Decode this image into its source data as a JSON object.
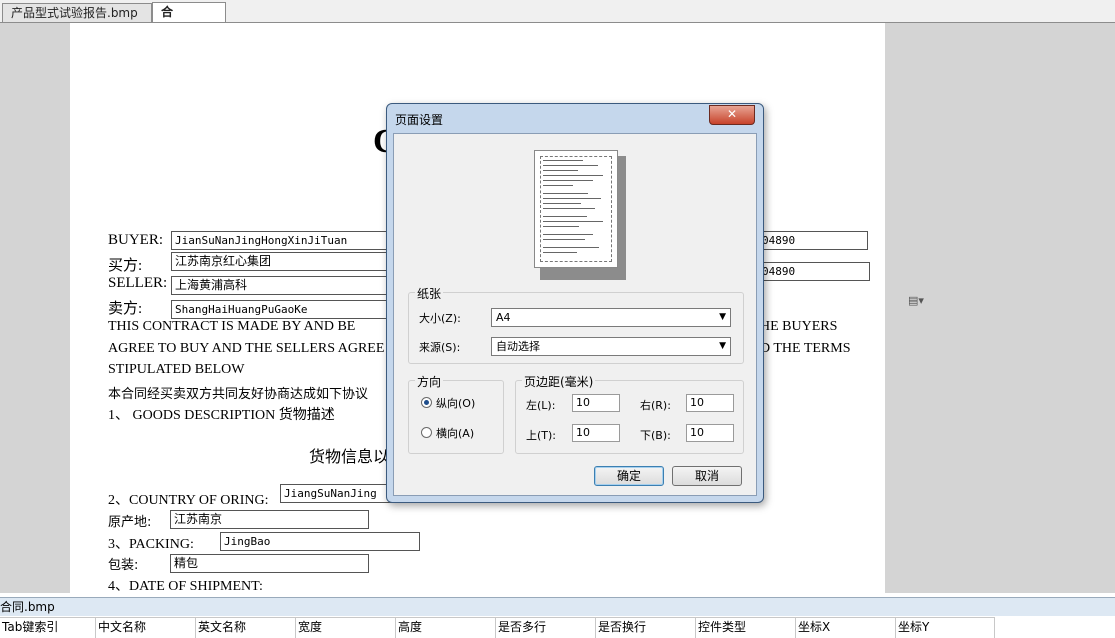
{
  "tabs": [
    {
      "label": "产品型式试验报告.bmp",
      "active": false
    },
    {
      "label": "合同.bmp",
      "active": true
    }
  ],
  "document": {
    "title_partial": "C",
    "buyer_label": "BUYER:",
    "buyer_value": "JianSuNanJingHongXinJiTuan",
    "buyer_cn_label": "买方:",
    "buyer_cn_value": "江苏南京红心集团",
    "seller_label": "SELLER:",
    "seller_value": "上海黄浦高科",
    "seller_cn_label": "卖方:",
    "seller_cn_value": "ShangHaiHuangPuGaoKe",
    "right_field_1": "04890",
    "right_field_2": "04890",
    "para_line1_left": "THIS  CONTRACT  IS  MADE  BY  AND  BE",
    "para_line1_right": "HE  BUYERS",
    "para_line2_left": "AGREE TO BUY AND THE SELLERS AGREE",
    "para_line2_right": "D THE TERMS",
    "para_line3": "STIPULATED BELOW",
    "cn_para": "本合同经买卖双方共同友好协商达成如下协议",
    "section1": "1、 GOODS DESCRIPTION  货物描述",
    "goods_info": "货物信息以",
    "section2": "2、COUNTRY OF ORING:",
    "section2_value": "JiangSuNanJing",
    "origin_label": "原产地:",
    "origin_value": "江苏南京",
    "section3": "3、PACKING:",
    "section3_value": "JingBao",
    "packing_label": "包装:",
    "packing_value": "精包",
    "section4": "4、DATE OF SHIPMENT:"
  },
  "dialog": {
    "title": "页面设置",
    "close": "✕",
    "paper_group": "纸张",
    "size_label": "大小(Z):",
    "size_value": "A4",
    "source_label": "来源(S):",
    "source_value": "自动选择",
    "orientation_group": "方向",
    "portrait": "纵向(O)",
    "landscape": "横向(A)",
    "margins_group": "页边距(毫米)",
    "left_label": "左(L):",
    "left_value": "10",
    "right_label": "右(R):",
    "right_value": "10",
    "top_label": "上(T):",
    "top_value": "10",
    "bottom_label": "下(B):",
    "bottom_value": "10",
    "ok": "确定",
    "cancel": "取消"
  },
  "bottom_panel": {
    "title": "合同.bmp",
    "columns": [
      "Tab键索引",
      "中文名称",
      "英文名称",
      "宽度",
      "高度",
      "是否多行",
      "是否换行",
      "控件类型",
      "坐标X",
      "坐标Y"
    ]
  }
}
